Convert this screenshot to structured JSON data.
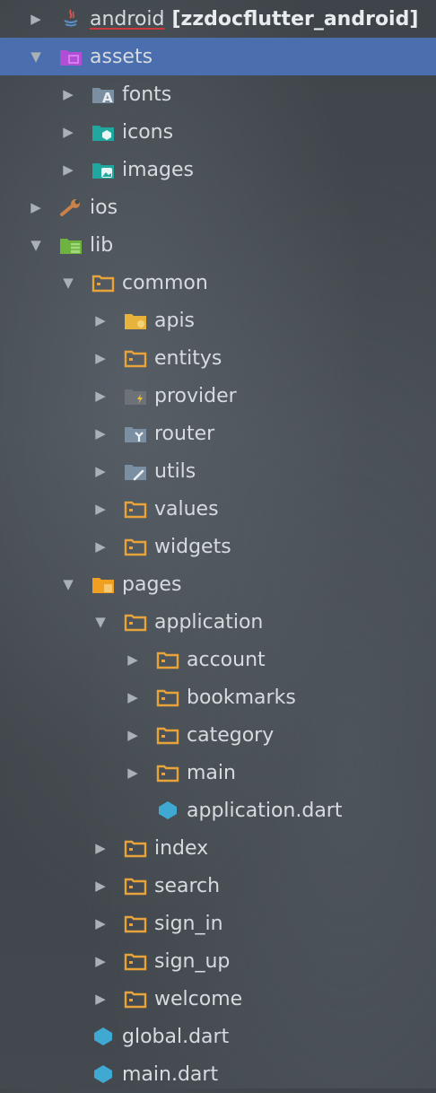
{
  "tree": [
    {
      "label": "android",
      "suffix": "[zzdocflutter_android]",
      "icon": "java-module-icon",
      "expanded": false
    },
    {
      "label": "assets",
      "icon": "assets-folder-icon",
      "expanded": true,
      "selected": true
    },
    {
      "label": "fonts",
      "icon": "fonts-folder-icon",
      "expanded": false
    },
    {
      "label": "icons",
      "icon": "icons-folder-icon",
      "expanded": false
    },
    {
      "label": "images",
      "icon": "images-folder-icon",
      "expanded": false
    },
    {
      "label": "ios",
      "icon": "ios-wrench-icon",
      "expanded": false
    },
    {
      "label": "lib",
      "icon": "lib-folder-icon",
      "expanded": true
    },
    {
      "label": "common",
      "icon": "folder-icon",
      "expanded": true
    },
    {
      "label": "apis",
      "icon": "apis-folder-icon",
      "expanded": false
    },
    {
      "label": "entitys",
      "icon": "folder-icon",
      "expanded": false
    },
    {
      "label": "provider",
      "icon": "provider-folder-icon",
      "expanded": false
    },
    {
      "label": "router",
      "icon": "router-folder-icon",
      "expanded": false
    },
    {
      "label": "utils",
      "icon": "utils-folder-icon",
      "expanded": false
    },
    {
      "label": "values",
      "icon": "folder-icon",
      "expanded": false
    },
    {
      "label": "widgets",
      "icon": "folder-icon",
      "expanded": false
    },
    {
      "label": "pages",
      "icon": "pages-folder-icon",
      "expanded": true
    },
    {
      "label": "application",
      "icon": "folder-icon",
      "expanded": true
    },
    {
      "label": "account",
      "icon": "folder-icon",
      "expanded": false
    },
    {
      "label": "bookmarks",
      "icon": "folder-icon",
      "expanded": false
    },
    {
      "label": "category",
      "icon": "folder-icon",
      "expanded": false
    },
    {
      "label": "main",
      "icon": "folder-icon",
      "expanded": false
    },
    {
      "label": "application.dart",
      "icon": "dart-file-icon",
      "expanded": null
    },
    {
      "label": "index",
      "icon": "folder-icon",
      "expanded": false
    },
    {
      "label": "search",
      "icon": "folder-icon",
      "expanded": false
    },
    {
      "label": "sign_in",
      "icon": "folder-icon",
      "expanded": false
    },
    {
      "label": "sign_up",
      "icon": "folder-icon",
      "expanded": false
    },
    {
      "label": "welcome",
      "icon": "folder-icon",
      "expanded": false
    },
    {
      "label": "global.dart",
      "icon": "dart-file-icon",
      "expanded": null
    },
    {
      "label": "main.dart",
      "icon": "dart-file-icon",
      "expanded": null
    }
  ],
  "colors": {
    "selection": "#4b6eaf",
    "folder": "#e8a33b",
    "dart": "#3fa9d3",
    "text": "#d6dbe0"
  }
}
